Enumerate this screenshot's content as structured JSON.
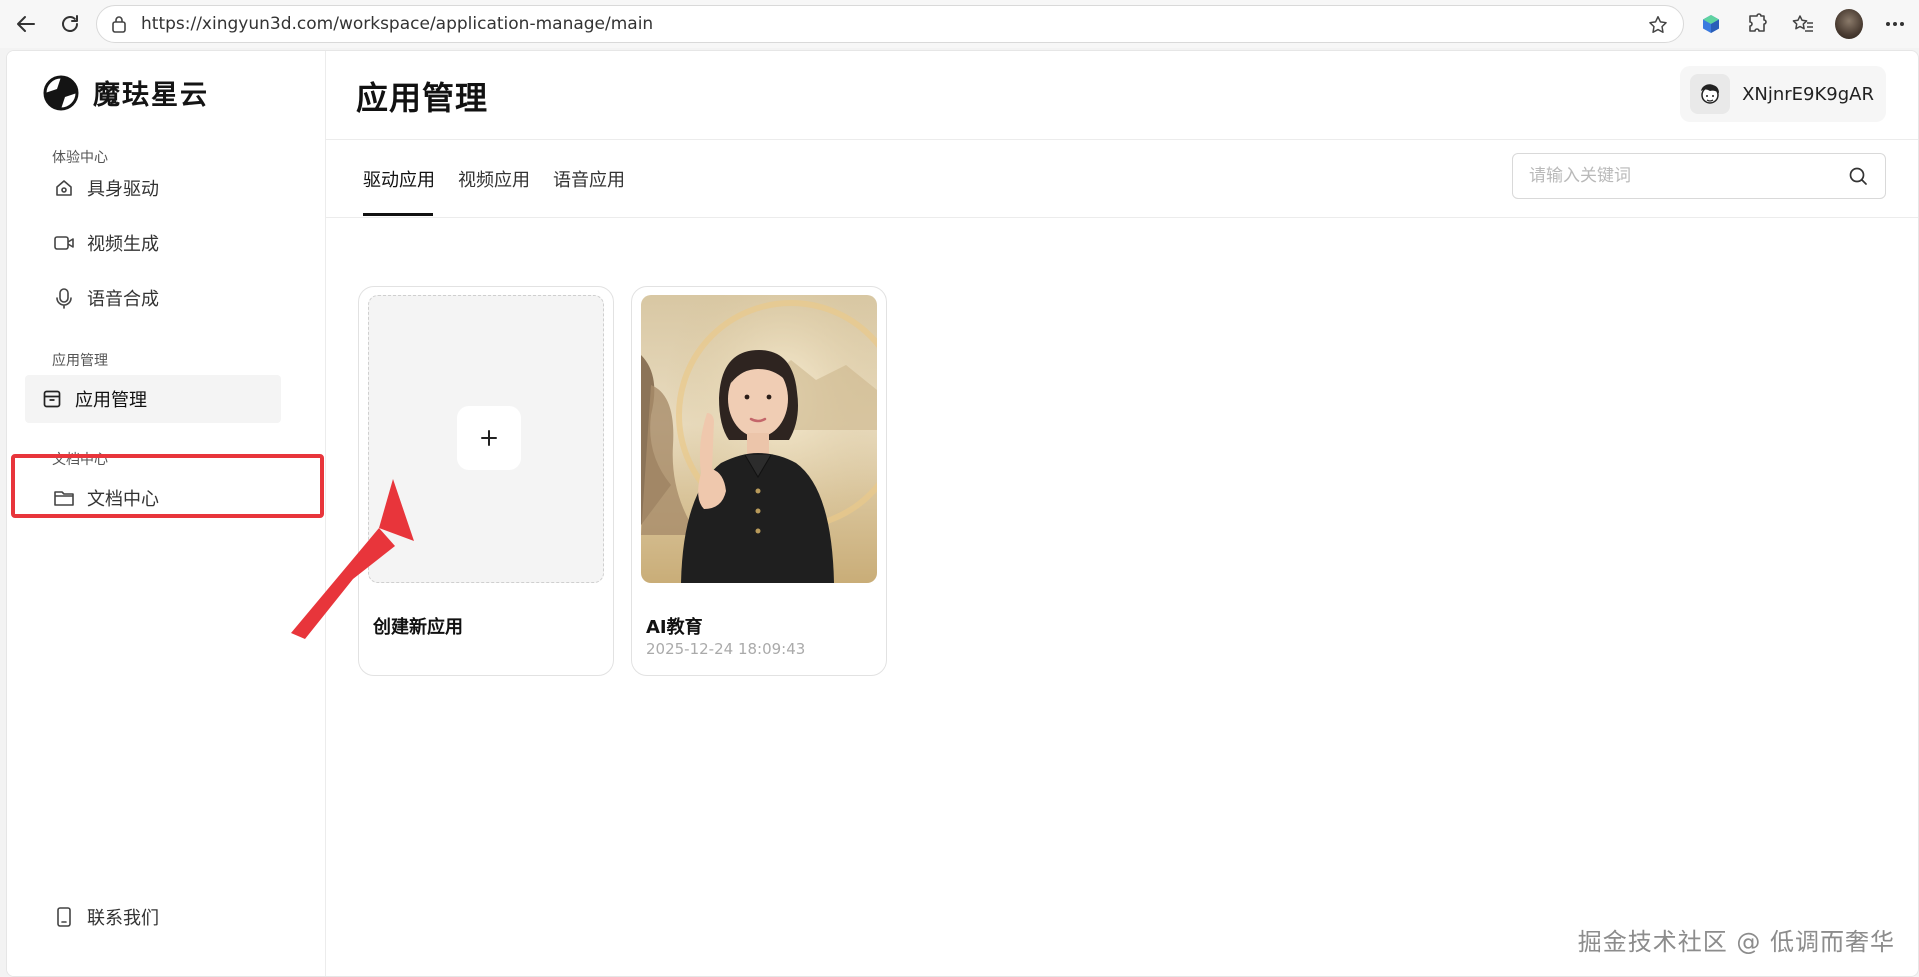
{
  "browser": {
    "url": "https://xingyun3d.com/workspace/application-manage/main"
  },
  "brand": {
    "name": "魔珐星云"
  },
  "sidebar": {
    "sections": [
      {
        "label": "体验中心",
        "items": [
          {
            "label": "具身驱动",
            "icon": "home-icon"
          },
          {
            "label": "视频生成",
            "icon": "video-icon"
          },
          {
            "label": "语音合成",
            "icon": "microphone-icon"
          }
        ]
      },
      {
        "label": "应用管理",
        "items": [
          {
            "label": "应用管理",
            "icon": "app-box-icon",
            "active": true
          }
        ]
      },
      {
        "label": "文档中心",
        "items": [
          {
            "label": "文档中心",
            "icon": "folder-icon"
          }
        ]
      }
    ],
    "footer": {
      "label": "联系我们",
      "icon": "phone-icon"
    }
  },
  "header": {
    "title": "应用管理",
    "user": {
      "name": "XNjnrE9K9gAR"
    }
  },
  "tabs": [
    {
      "label": "驱动应用",
      "active": true
    },
    {
      "label": "视频应用"
    },
    {
      "label": "语音应用"
    }
  ],
  "search": {
    "placeholder": "请输入关键词",
    "value": ""
  },
  "cards": [
    {
      "title": "创建新应用",
      "type": "create"
    },
    {
      "title": "AI教育",
      "time": "2025-12-24 18:09:43",
      "type": "app"
    }
  ],
  "watermark": "掘金技术社区 @ 低调而奢华",
  "colors": {
    "highlight": "#e8353b",
    "accent": "#111111"
  }
}
